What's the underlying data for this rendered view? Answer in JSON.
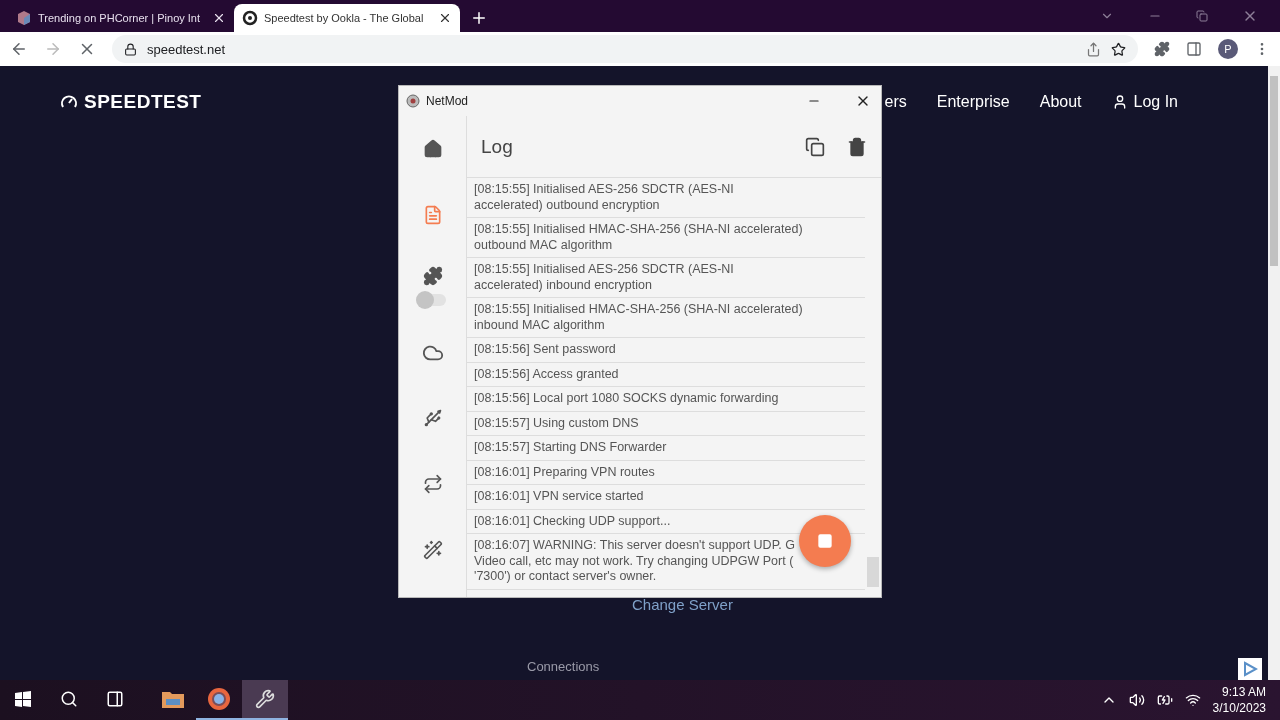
{
  "browser": {
    "tabs": [
      {
        "title": "Trending on PHCorner | Pinoy Int",
        "selected": false
      },
      {
        "title": "Speedtest by Ookla - The Global",
        "selected": true
      }
    ],
    "address": "speedtest.net",
    "profile_initial": "P"
  },
  "page": {
    "logo": "SPEEDTEST",
    "nav": [
      "ers",
      "Enterprise",
      "About",
      "Log In"
    ],
    "change_server": "Change Server",
    "connections": "Connections"
  },
  "netmod": {
    "title": "NetMod",
    "heading": "Log",
    "sidebar": [
      {
        "kind": "home",
        "selected": false
      },
      {
        "kind": "log",
        "selected": true
      },
      {
        "kind": "plugin",
        "selected": false,
        "toggle_on": false
      },
      {
        "kind": "cloud",
        "selected": false
      },
      {
        "kind": "usb",
        "selected": false
      },
      {
        "kind": "repeat",
        "selected": false
      },
      {
        "kind": "wand",
        "selected": false
      }
    ],
    "log": [
      "[08:15:55] Initialised AES-256 SDCTR (AES-NI accelerated) outbound encryption",
      "[08:15:55] Initialised HMAC-SHA-256 (SHA-NI accelerated) outbound MAC algorithm",
      "[08:15:55] Initialised AES-256 SDCTR (AES-NI accelerated) inbound encryption",
      "[08:15:55] Initialised HMAC-SHA-256 (SHA-NI accelerated) inbound MAC algorithm",
      "[08:15:56] Sent password",
      "[08:15:56] Access granted",
      "[08:15:56] Local port 1080 SOCKS dynamic forwarding",
      "[08:15:57] Using custom DNS",
      "[08:15:57] Starting DNS Forwarder",
      "[08:16:01] Preparing VPN routes",
      "[08:16:01] VPN service started",
      "[08:16:01] Checking UDP support...",
      "[08:16:07] WARNING: This server doesn't support UDP. G Video call, etc may not work. Try changing UDPGW Port ( '7300') or contact server's owner."
    ]
  },
  "taskbar": {
    "apps": [
      {
        "kind": "explorer",
        "selected": false,
        "running": false
      },
      {
        "kind": "chrome",
        "selected": false,
        "running": true
      },
      {
        "kind": "netmod",
        "selected": true,
        "running": true
      }
    ],
    "time": "9:13 AM",
    "date": "3/10/2023"
  }
}
